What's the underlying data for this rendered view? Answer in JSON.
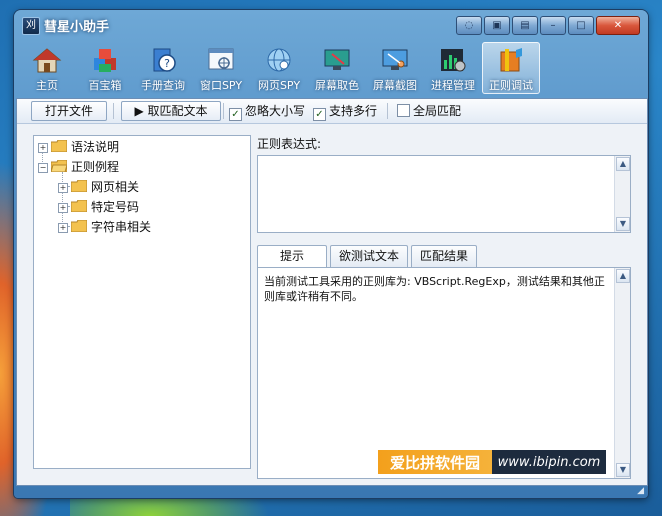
{
  "window": {
    "title": "彗星小助手",
    "app_icon_glyph": "刈",
    "controls": [
      "chat-icon",
      "skin-icon",
      "menu-icon",
      "minimize-icon",
      "maximize-icon",
      "close-icon"
    ]
  },
  "nav": {
    "items": [
      {
        "label": "主页",
        "icon": "home-icon"
      },
      {
        "label": "百宝箱",
        "icon": "toolbox-icon"
      },
      {
        "label": "手册查询",
        "icon": "manual-icon"
      },
      {
        "label": "窗口SPY",
        "icon": "window-spy-icon"
      },
      {
        "label": "网页SPY",
        "icon": "web-spy-icon"
      },
      {
        "label": "屏幕取色",
        "icon": "color-picker-icon"
      },
      {
        "label": "屏幕截图",
        "icon": "screenshot-icon"
      },
      {
        "label": "进程管理",
        "icon": "process-icon"
      },
      {
        "label": "正则调试",
        "icon": "regex-icon"
      }
    ],
    "active_index": 8
  },
  "toolbar": {
    "open_file": "打开文件",
    "get_match_text": "▶ 取匹配文本",
    "ignore_case": {
      "label": "忽略大小写",
      "checked": true
    },
    "multiline": {
      "label": "支持多行",
      "checked": true
    },
    "global_match": {
      "label": "全局匹配",
      "checked": false
    }
  },
  "tree": {
    "nodes": [
      {
        "label": "语法说明",
        "expanded": false
      },
      {
        "label": "正则例程",
        "expanded": true,
        "children": [
          {
            "label": "网页相关"
          },
          {
            "label": "特定号码"
          },
          {
            "label": "字符串相关"
          }
        ]
      }
    ]
  },
  "regex": {
    "label": "正则表达式:",
    "value": ""
  },
  "tabs": {
    "items": [
      "提示",
      "欲测试文本",
      "匹配结果"
    ],
    "active_index": 0
  },
  "tip": {
    "text": "当前测试工具采用的正则库为: VBScript.RegExp，测试结果和其他正则库或许稍有不同。"
  },
  "watermark": {
    "left": "爱比拼软件园",
    "right": "www.ibipin.com"
  },
  "colors": {
    "window_frame": "#4b89c2",
    "client_bg": "#eef2f7",
    "close_button": "#d9573c",
    "watermark_orange": "#f3a01c"
  }
}
